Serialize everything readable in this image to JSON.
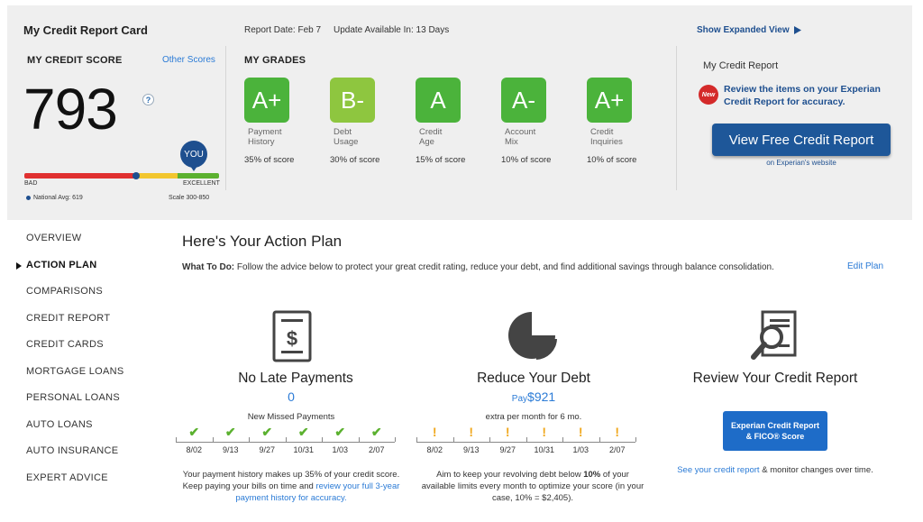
{
  "header": {
    "title": "My Credit Report Card",
    "report_date": "Report Date: Feb 7",
    "update_available": "Update Available In: 13 Days",
    "show_expanded": "Show Expanded View"
  },
  "score": {
    "section_title": "MY CREDIT SCORE",
    "other_scores": "Other Scores",
    "value": "793",
    "help_icon": "?",
    "you_badge": "YOU",
    "bad_label": "BAD",
    "excellent_label": "EXCELLENT",
    "national_avg": "National Avg: 619",
    "scale": "Scale 300-850",
    "colors": [
      "#e03030",
      "#f2c62e",
      "#5bb12f"
    ]
  },
  "grades": {
    "section_title": "MY GRADES",
    "items": [
      {
        "grade": "A+",
        "label1": "Payment",
        "label2": "History",
        "pct": "35% of score",
        "color": "#4bb33b"
      },
      {
        "grade": "B-",
        "label1": "Debt",
        "label2": "Usage",
        "pct": "30% of score",
        "color": "#8ec63f"
      },
      {
        "grade": "A",
        "label1": "Credit",
        "label2": "Age",
        "pct": "15% of score",
        "color": "#4bb33b"
      },
      {
        "grade": "A-",
        "label1": "Account",
        "label2": "Mix",
        "pct": "10% of score",
        "color": "#4bb33b"
      },
      {
        "grade": "A+",
        "label1": "Credit",
        "label2": "Inquiries",
        "pct": "10% of score",
        "color": "#4bb33b"
      }
    ]
  },
  "report_panel": {
    "title": "My Credit Report",
    "new_badge": "New",
    "message": "Review the items on your Experian Credit Report for accuracy.",
    "button": "View Free Credit Report",
    "sub": "on Experian's website"
  },
  "sidebar": {
    "items": [
      {
        "label": "OVERVIEW"
      },
      {
        "label": "ACTION PLAN",
        "active": true
      },
      {
        "label": "COMPARISONS"
      },
      {
        "label": "CREDIT REPORT"
      },
      {
        "label": "CREDIT CARDS"
      },
      {
        "label": "MORTGAGE LOANS"
      },
      {
        "label": "PERSONAL LOANS"
      },
      {
        "label": "AUTO LOANS"
      },
      {
        "label": "AUTO INSURANCE"
      },
      {
        "label": "EXPERT ADVICE"
      }
    ]
  },
  "action_plan": {
    "title": "Here's Your Action Plan",
    "what_to_do_label": "What To Do:",
    "what_to_do_text": "Follow the advice below to protect your great credit rating, reduce your debt, and find additional savings through balance consolidation.",
    "edit_plan": "Edit Plan",
    "cards": {
      "late": {
        "title": "No Late Payments",
        "value": "0",
        "sub": "New Missed Payments",
        "dates": [
          "8/02",
          "9/13",
          "9/27",
          "10/31",
          "1/03",
          "2/07"
        ],
        "desc_part1": "Your payment history makes up 35% of your credit score. Keep paying your bills on time and ",
        "desc_link": "review your full 3-year payment history for accuracy."
      },
      "debt": {
        "title": "Reduce Your Debt",
        "pay_label": "Pay",
        "value": "$921",
        "sub": "extra per month for 6 mo.",
        "dates": [
          "8/02",
          "9/13",
          "9/27",
          "10/31",
          "1/03",
          "2/07"
        ],
        "desc_part1": "Aim to keep your revolving debt below ",
        "desc_bold": "10%",
        "desc_part2": " of your available limits every month to optimize your score (in your case, 10% = $2,405)."
      },
      "review": {
        "title": "Review Your Credit Report",
        "button_line1": "Experian Credit Report",
        "button_line2": "& FICO® Score",
        "link": "See your credit report",
        "link_suffix": " & monitor changes over time."
      }
    }
  }
}
